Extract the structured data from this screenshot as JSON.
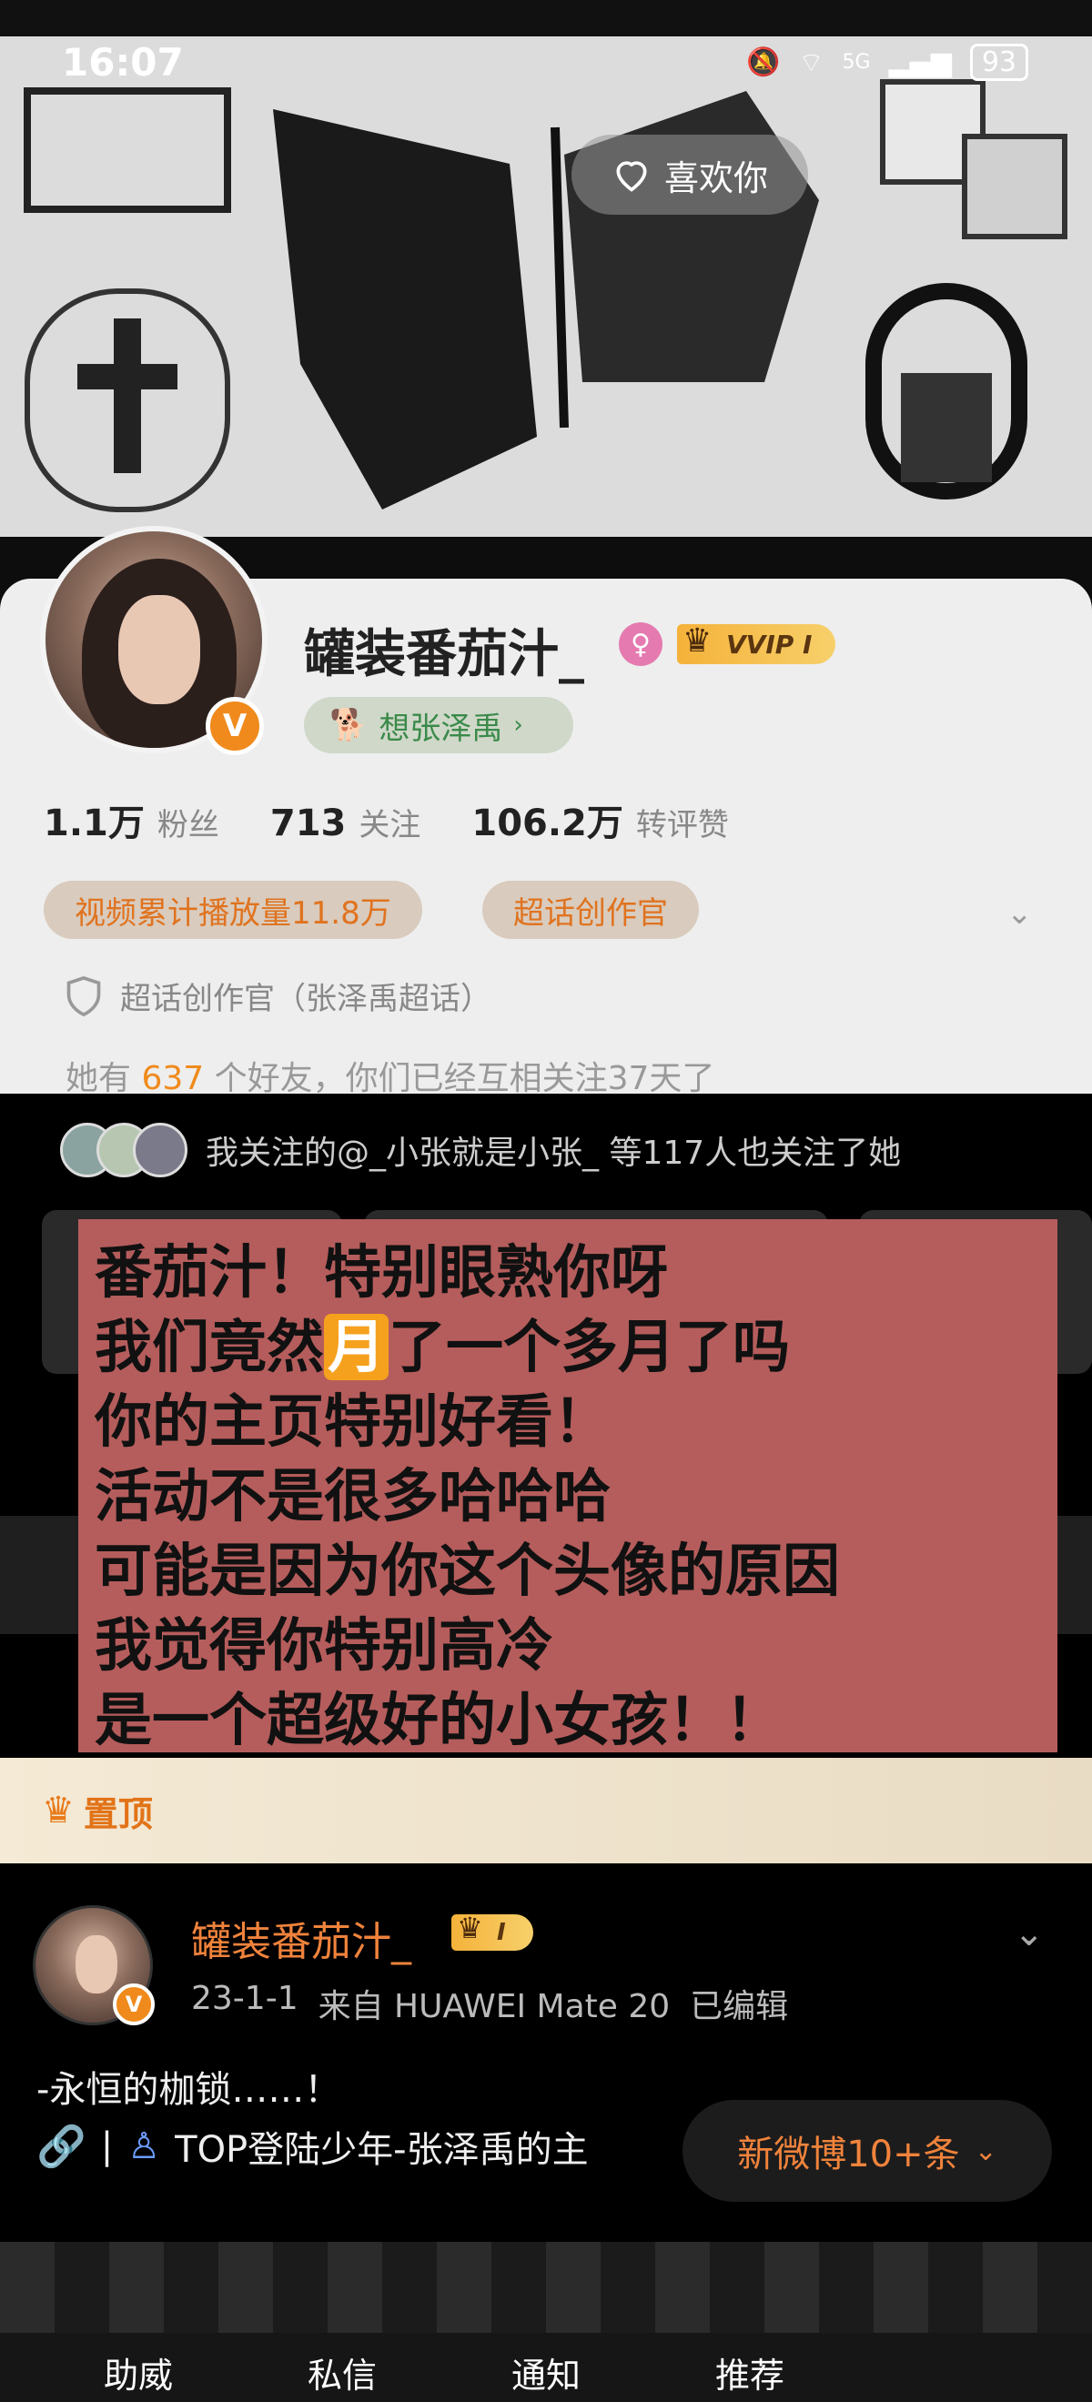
{
  "status_bar": {
    "time": "16:07",
    "network": "5G",
    "battery": "93"
  },
  "banner": {
    "like_button": "喜欢你"
  },
  "profile": {
    "name": "罐装番茄汁_",
    "vip_badge": "VVIP I",
    "verified_badge": "V",
    "supertopic_chip": "想张泽禹",
    "stats": [
      {
        "number": "1.1万",
        "label": "粉丝"
      },
      {
        "number": "713",
        "label": "关注"
      },
      {
        "number": "106.2万",
        "label": "转评赞"
      }
    ],
    "pills": [
      "视频累计播放量11.8万",
      "超话创作官"
    ],
    "creator_line": "超话创作官（张泽禹超话）",
    "friends": {
      "prefix": "她有 ",
      "count": "637",
      "suffix": " 个好友，你们已经互相关注37天了"
    },
    "mutual_follow": "我关注的@_小张就是小张_ 等117人也关注了她"
  },
  "note_overlay": {
    "lines": [
      "番茄汁！特别眼熟你呀",
      "我们竟然",
      "月",
      "了一个多月了吗",
      "你的主页特别好看！",
      "活动不是很多哈哈哈",
      "可能是因为你这个头像的原因",
      "我觉得你特别高冷",
      "是一个超级好的小女孩！！"
    ]
  },
  "pinned": {
    "label": "置顶"
  },
  "post": {
    "author": "罐装番茄汁_",
    "vip_badge": "I",
    "date": "23-1-1",
    "source": "来自 HUAWEI Mate 20",
    "edited": "已编辑",
    "text": "-永恒的枷锁……！",
    "link_text": "TOP登陆少年-张泽禹的主"
  },
  "new_posts_button": "新微博10+条",
  "bottom_nav": [
    "助威",
    "私信",
    "通知",
    "推荐"
  ],
  "colors": {
    "accent_orange": "#f0833c",
    "note_background": "#b55d5c",
    "vip_gold": "#f5b23a"
  }
}
